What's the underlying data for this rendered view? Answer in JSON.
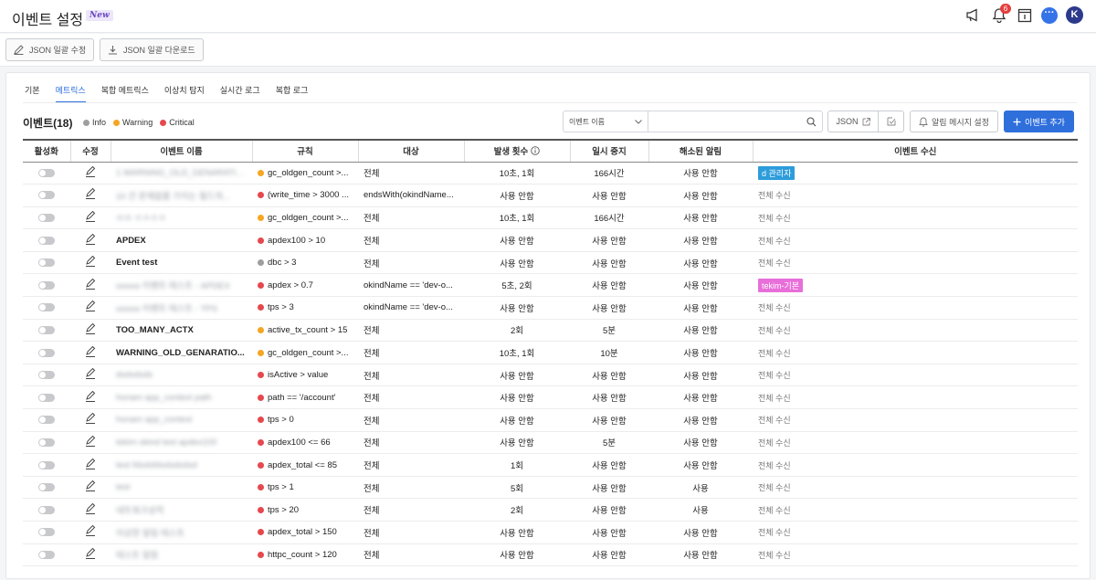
{
  "header": {
    "title": "이벤트 설정",
    "new_badge": "New",
    "notification_count": "6",
    "chat_label": "···",
    "avatar_initial": "K"
  },
  "toolbar": {
    "json_bulk_edit": "JSON 일괄 수정",
    "json_bulk_download": "JSON 일괄 다운로드"
  },
  "tabs": [
    "기본",
    "메트릭스",
    "복합 메트릭스",
    "이상치 탐지",
    "실시간 로그",
    "복합 로그"
  ],
  "active_tab": "메트릭스",
  "events": {
    "title": "이벤트(18)",
    "legend": [
      {
        "label": "Info",
        "color": "#9e9e9e"
      },
      {
        "label": "Warning",
        "color": "#f5a623"
      },
      {
        "label": "Critical",
        "color": "#e5484d"
      }
    ]
  },
  "search": {
    "select_value": "이벤트 이름",
    "placeholder": ""
  },
  "buttons": {
    "json": "JSON",
    "alarm_settings": "알림 메시지 설정",
    "add_event": "이벤트 추가"
  },
  "columns": [
    "활성화",
    "수정",
    "이벤트 이름",
    "규칙",
    "대상",
    "발생 횟수",
    "일시 중지",
    "해소된 알림",
    "이벤트 수신"
  ],
  "colors": {
    "info": "#9e9e9e",
    "warning": "#f5a623",
    "critical": "#e5484d",
    "primary": "#2f6fdc",
    "tag_blue": "#2d9cdb",
    "tag_pink": "#e86fd9"
  },
  "rows": [
    {
      "name": "1 WARNING_OLD_GENARATI...",
      "blur": true,
      "level": "warning",
      "rule": "gc_oldgen_count >...",
      "target": "전체",
      "count": "10초, 1회",
      "pause": "166시간",
      "resolved": "사용 안함",
      "receive": "d 관리자",
      "receive_tag": "blue"
    },
    {
      "name": "10 건 문제없를 가지는 필드의...",
      "blur": true,
      "level": "critical",
      "rule": "(write_time > 3000 ...",
      "target": "endsWith(okindName...",
      "count": "사용 안함",
      "pause": "사용 안함",
      "resolved": "사용 안함",
      "receive": "전체 수신",
      "receive_tag": ""
    },
    {
      "name": "ㅁㅁ ㅇㅇㅇㅇ",
      "blur": true,
      "level": "warning",
      "rule": "gc_oldgen_count >...",
      "target": "전체",
      "count": "10초, 1회",
      "pause": "166시간",
      "resolved": "사용 안함",
      "receive": "전체 수신",
      "receive_tag": ""
    },
    {
      "name": "APDEX",
      "blur": false,
      "level": "critical",
      "rule": "apdex100 > 10",
      "target": "전체",
      "count": "사용 안함",
      "pause": "사용 안함",
      "resolved": "사용 안함",
      "receive": "전체 수신",
      "receive_tag": ""
    },
    {
      "name": "Event test",
      "blur": false,
      "level": "info",
      "rule": "dbc > 3",
      "target": "전체",
      "count": "사용 안함",
      "pause": "사용 안함",
      "resolved": "사용 안함",
      "receive": "전체 수신",
      "receive_tag": ""
    },
    {
      "name": "ooooo 이벤트 테스트 - APDEX",
      "blur": true,
      "level": "critical",
      "rule": "apdex > 0.7",
      "target": "okindName == 'dev-o...",
      "count": "5초, 2회",
      "pause": "사용 안함",
      "resolved": "사용 안함",
      "receive": "tekim-기본",
      "receive_tag": "pink"
    },
    {
      "name": "ooooo 이벤트 테스트 - TPS",
      "blur": true,
      "level": "critical",
      "rule": "tps > 3",
      "target": "okindName == 'dev-o...",
      "count": "사용 안함",
      "pause": "사용 안함",
      "resolved": "사용 안함",
      "receive": "전체 수신",
      "receive_tag": ""
    },
    {
      "name": "TOO_MANY_ACTX",
      "blur": false,
      "level": "warning",
      "rule": "active_tx_count > 15",
      "target": "전체",
      "count": "2회",
      "pause": "5분",
      "resolved": "사용 안함",
      "receive": "전체 수신",
      "receive_tag": ""
    },
    {
      "name": "WARNING_OLD_GENARATIO...",
      "blur": false,
      "level": "warning",
      "rule": "gc_oldgen_count >...",
      "target": "전체",
      "count": "10초, 1회",
      "pause": "10분",
      "resolved": "사용 안함",
      "receive": "전체 수신",
      "receive_tag": ""
    },
    {
      "name": "dsdsdsds",
      "blur": true,
      "level": "critical",
      "rule": "isActive > value",
      "target": "전체",
      "count": "사용 안함",
      "pause": "사용 안함",
      "resolved": "사용 안함",
      "receive": "전체 수신",
      "receive_tag": ""
    },
    {
      "name": "honam app_context path",
      "blur": true,
      "level": "critical",
      "rule": "path == '/account'",
      "target": "전체",
      "count": "사용 안함",
      "pause": "사용 안함",
      "resolved": "사용 안함",
      "receive": "전체 수신",
      "receive_tag": ""
    },
    {
      "name": "honam app_context",
      "blur": true,
      "level": "critical",
      "rule": "tps > 0",
      "target": "전체",
      "count": "사용 안함",
      "pause": "사용 안함",
      "resolved": "사용 안함",
      "receive": "전체 수신",
      "receive_tag": ""
    },
    {
      "name": "tekim okind test apdex100",
      "blur": true,
      "level": "critical",
      "rule": "apdex100 <= 66",
      "target": "전체",
      "count": "사용 안함",
      "pause": "5분",
      "resolved": "사용 안함",
      "receive": "전체 수신",
      "receive_tag": ""
    },
    {
      "name": "test fdsdsfdsdsdsdsd",
      "blur": true,
      "level": "critical",
      "rule": "apdex_total <= 85",
      "target": "전체",
      "count": "1회",
      "pause": "사용 안함",
      "resolved": "사용 안함",
      "receive": "전체 수신",
      "receive_tag": ""
    },
    {
      "name": "test",
      "blur": true,
      "level": "critical",
      "rule": "tps > 1",
      "target": "전체",
      "count": "5회",
      "pause": "사용 안함",
      "resolved": "사용",
      "receive": "전체 수신",
      "receive_tag": ""
    },
    {
      "name": "네트워크성적",
      "blur": true,
      "level": "critical",
      "rule": "tps > 20",
      "target": "전체",
      "count": "2회",
      "pause": "사용 안함",
      "resolved": "사용",
      "receive": "전체 수신",
      "receive_tag": ""
    },
    {
      "name": "이상한 알림 테스트",
      "blur": true,
      "level": "critical",
      "rule": "apdex_total > 150",
      "target": "전체",
      "count": "사용 안함",
      "pause": "사용 안함",
      "resolved": "사용 안함",
      "receive": "전체 수신",
      "receive_tag": ""
    },
    {
      "name": "테스트 알람",
      "blur": true,
      "level": "critical",
      "rule": "httpc_count > 120",
      "target": "전체",
      "count": "사용 안함",
      "pause": "사용 안함",
      "resolved": "사용 안함",
      "receive": "전체 수신",
      "receive_tag": ""
    }
  ]
}
